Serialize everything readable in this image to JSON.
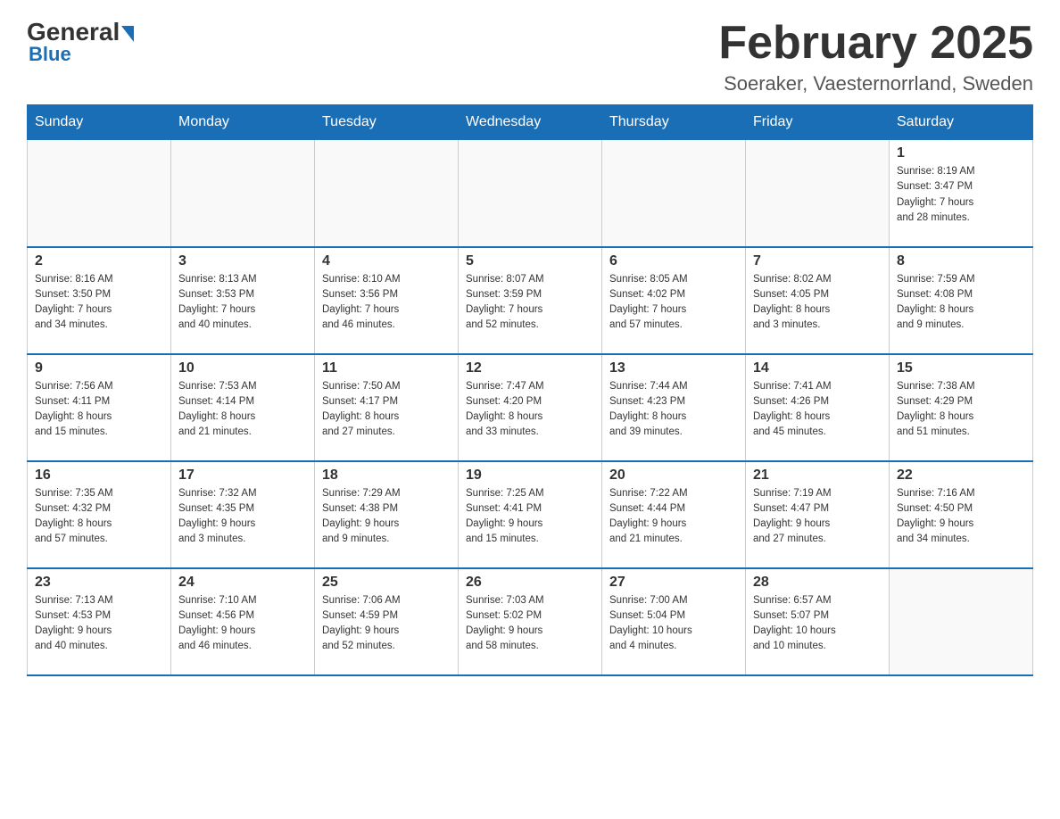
{
  "header": {
    "logo_general": "General",
    "logo_blue": "Blue",
    "month_title": "February 2025",
    "location": "Soeraker, Vaesternorrland, Sweden"
  },
  "weekdays": [
    "Sunday",
    "Monday",
    "Tuesday",
    "Wednesday",
    "Thursday",
    "Friday",
    "Saturday"
  ],
  "weeks": [
    [
      {
        "day": "",
        "info": ""
      },
      {
        "day": "",
        "info": ""
      },
      {
        "day": "",
        "info": ""
      },
      {
        "day": "",
        "info": ""
      },
      {
        "day": "",
        "info": ""
      },
      {
        "day": "",
        "info": ""
      },
      {
        "day": "1",
        "info": "Sunrise: 8:19 AM\nSunset: 3:47 PM\nDaylight: 7 hours\nand 28 minutes."
      }
    ],
    [
      {
        "day": "2",
        "info": "Sunrise: 8:16 AM\nSunset: 3:50 PM\nDaylight: 7 hours\nand 34 minutes."
      },
      {
        "day": "3",
        "info": "Sunrise: 8:13 AM\nSunset: 3:53 PM\nDaylight: 7 hours\nand 40 minutes."
      },
      {
        "day": "4",
        "info": "Sunrise: 8:10 AM\nSunset: 3:56 PM\nDaylight: 7 hours\nand 46 minutes."
      },
      {
        "day": "5",
        "info": "Sunrise: 8:07 AM\nSunset: 3:59 PM\nDaylight: 7 hours\nand 52 minutes."
      },
      {
        "day": "6",
        "info": "Sunrise: 8:05 AM\nSunset: 4:02 PM\nDaylight: 7 hours\nand 57 minutes."
      },
      {
        "day": "7",
        "info": "Sunrise: 8:02 AM\nSunset: 4:05 PM\nDaylight: 8 hours\nand 3 minutes."
      },
      {
        "day": "8",
        "info": "Sunrise: 7:59 AM\nSunset: 4:08 PM\nDaylight: 8 hours\nand 9 minutes."
      }
    ],
    [
      {
        "day": "9",
        "info": "Sunrise: 7:56 AM\nSunset: 4:11 PM\nDaylight: 8 hours\nand 15 minutes."
      },
      {
        "day": "10",
        "info": "Sunrise: 7:53 AM\nSunset: 4:14 PM\nDaylight: 8 hours\nand 21 minutes."
      },
      {
        "day": "11",
        "info": "Sunrise: 7:50 AM\nSunset: 4:17 PM\nDaylight: 8 hours\nand 27 minutes."
      },
      {
        "day": "12",
        "info": "Sunrise: 7:47 AM\nSunset: 4:20 PM\nDaylight: 8 hours\nand 33 minutes."
      },
      {
        "day": "13",
        "info": "Sunrise: 7:44 AM\nSunset: 4:23 PM\nDaylight: 8 hours\nand 39 minutes."
      },
      {
        "day": "14",
        "info": "Sunrise: 7:41 AM\nSunset: 4:26 PM\nDaylight: 8 hours\nand 45 minutes."
      },
      {
        "day": "15",
        "info": "Sunrise: 7:38 AM\nSunset: 4:29 PM\nDaylight: 8 hours\nand 51 minutes."
      }
    ],
    [
      {
        "day": "16",
        "info": "Sunrise: 7:35 AM\nSunset: 4:32 PM\nDaylight: 8 hours\nand 57 minutes."
      },
      {
        "day": "17",
        "info": "Sunrise: 7:32 AM\nSunset: 4:35 PM\nDaylight: 9 hours\nand 3 minutes."
      },
      {
        "day": "18",
        "info": "Sunrise: 7:29 AM\nSunset: 4:38 PM\nDaylight: 9 hours\nand 9 minutes."
      },
      {
        "day": "19",
        "info": "Sunrise: 7:25 AM\nSunset: 4:41 PM\nDaylight: 9 hours\nand 15 minutes."
      },
      {
        "day": "20",
        "info": "Sunrise: 7:22 AM\nSunset: 4:44 PM\nDaylight: 9 hours\nand 21 minutes."
      },
      {
        "day": "21",
        "info": "Sunrise: 7:19 AM\nSunset: 4:47 PM\nDaylight: 9 hours\nand 27 minutes."
      },
      {
        "day": "22",
        "info": "Sunrise: 7:16 AM\nSunset: 4:50 PM\nDaylight: 9 hours\nand 34 minutes."
      }
    ],
    [
      {
        "day": "23",
        "info": "Sunrise: 7:13 AM\nSunset: 4:53 PM\nDaylight: 9 hours\nand 40 minutes."
      },
      {
        "day": "24",
        "info": "Sunrise: 7:10 AM\nSunset: 4:56 PM\nDaylight: 9 hours\nand 46 minutes."
      },
      {
        "day": "25",
        "info": "Sunrise: 7:06 AM\nSunset: 4:59 PM\nDaylight: 9 hours\nand 52 minutes."
      },
      {
        "day": "26",
        "info": "Sunrise: 7:03 AM\nSunset: 5:02 PM\nDaylight: 9 hours\nand 58 minutes."
      },
      {
        "day": "27",
        "info": "Sunrise: 7:00 AM\nSunset: 5:04 PM\nDaylight: 10 hours\nand 4 minutes."
      },
      {
        "day": "28",
        "info": "Sunrise: 6:57 AM\nSunset: 5:07 PM\nDaylight: 10 hours\nand 10 minutes."
      },
      {
        "day": "",
        "info": ""
      }
    ]
  ]
}
